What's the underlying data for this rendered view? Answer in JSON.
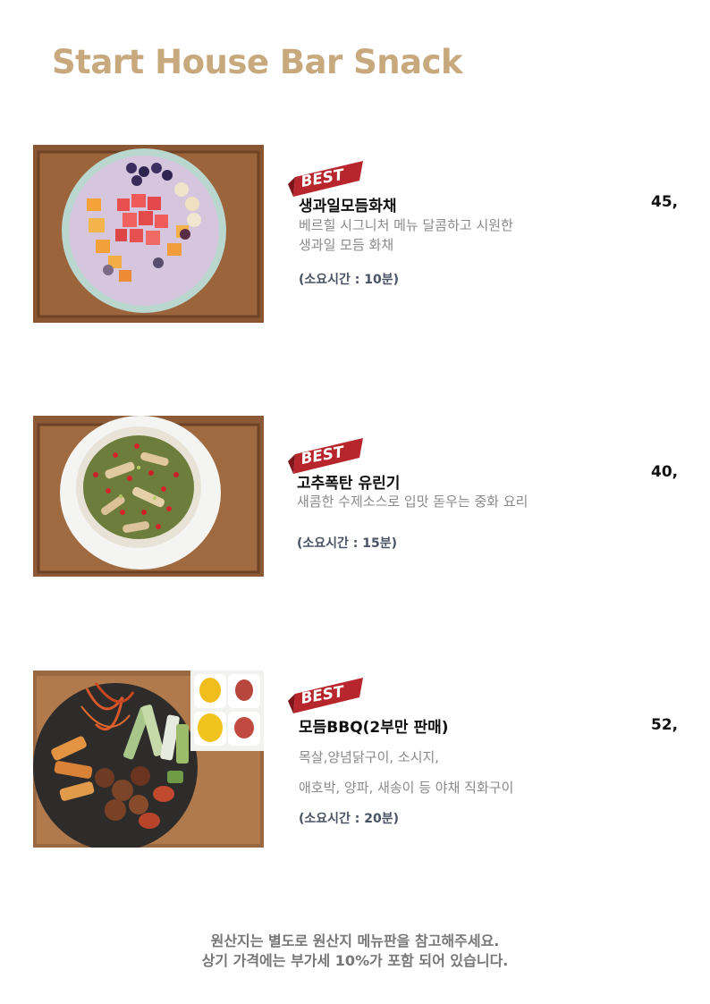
{
  "page_title": "Start House Bar Snack",
  "badge_text": "BEST",
  "items": [
    {
      "name": "생과일모듬화채",
      "price": "45,",
      "desc_lines": [
        "베르힐 시그니처 메뉴 달콤하고 시원한",
        "생과일 모듬 화채"
      ],
      "time": "(소요시간 : 10분)"
    },
    {
      "name": "고추폭탄 유린기",
      "price": "40,",
      "desc_lines": [
        "새콤한 수제소스로 입맛 돋우는 중화 요리"
      ],
      "time": "(소요시간 : 15분)"
    },
    {
      "name": "모듬BBQ(2부만 판매)",
      "price": "52,",
      "desc_lines": [
        "목살,양념닭구이, 소시지,",
        "애호박, 양파, 새송이 등 야채 직화구이"
      ],
      "time": "(소요시간 : 20분)"
    }
  ],
  "footer": {
    "line1": "원산지는 별도로 원산지 메뉴판을 참고해주세요.",
    "line2": "상기 가격에는 부가세 10%가 포함 되어 있습니다."
  },
  "colors": {
    "title": "#c8a97e",
    "badge_red": "#b8262d",
    "time_text": "#4a5363"
  }
}
